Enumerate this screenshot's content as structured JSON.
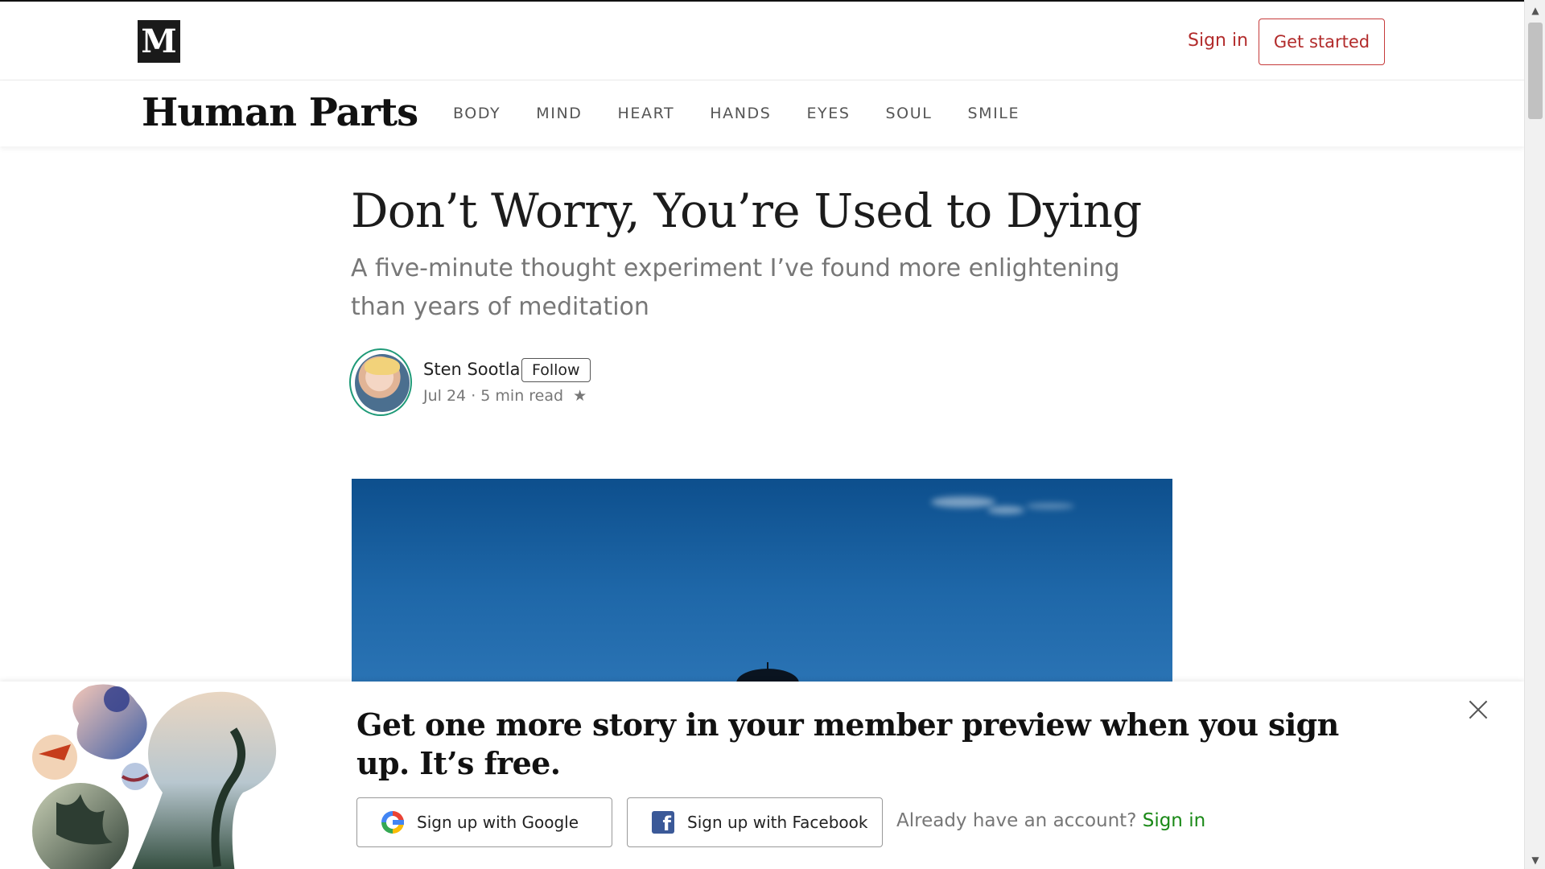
{
  "header": {
    "logo_letter": "M",
    "signin_label": "Sign in",
    "get_started_label": "Get started"
  },
  "publication": {
    "name": "Human Parts",
    "nav": [
      "BODY",
      "MIND",
      "HEART",
      "HANDS",
      "EYES",
      "SOUL",
      "SMILE"
    ]
  },
  "article": {
    "title": "Don’t Worry, You’re Used to Dying",
    "subtitle": "A five-minute thought experiment I’ve found more enlightening than years of meditation",
    "author": {
      "name": "Sten Sootla",
      "follow_label": "Follow",
      "date": "Jul 24",
      "read_time": "5 min read",
      "star": "★"
    }
  },
  "banner": {
    "headline": "Get one more story in your member preview when you sign up. It’s free.",
    "google_label": "Sign up with Google",
    "facebook_label": "Sign up with Facebook",
    "already_text": "Already have an account?",
    "signin_link": "Sign in"
  },
  "colors": {
    "accent_red": "#b22b2b",
    "member_green": "#1a8917",
    "avatar_ring": "#1f9a78",
    "facebook_blue": "#3b5998"
  },
  "icons": {
    "close": "close-icon",
    "google": "google-icon",
    "facebook": "facebook-icon",
    "star": "star-icon"
  }
}
